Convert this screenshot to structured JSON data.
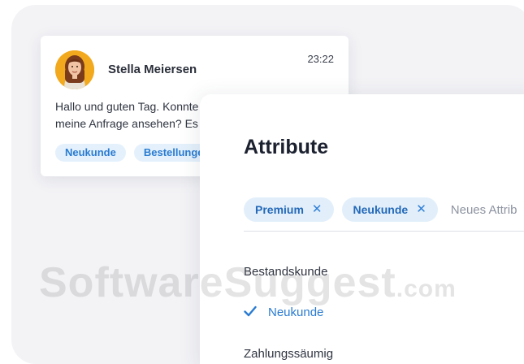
{
  "chat": {
    "name": "Stella Meiersen",
    "time": "23:22",
    "message_line1": "Hallo und guten Tag. Konnte",
    "message_line2": "meine Anfrage ansehen? Es",
    "tags": [
      "Neukunde",
      "Bestellunge"
    ]
  },
  "attributes": {
    "title": "Attribute",
    "selected_tags": [
      "Premium",
      "Neukunde"
    ],
    "input_placeholder": "Neues Attrib",
    "options": [
      {
        "label": "Bestandskunde",
        "selected": false
      },
      {
        "label": "Neukunde",
        "selected": true
      },
      {
        "label": "Zahlungssäumig",
        "selected": false
      }
    ],
    "remove_glyph": "✕"
  },
  "watermark": {
    "main": "SoftwareSuggest",
    "suffix": ".com"
  },
  "colors": {
    "accent": "#2a7bd1",
    "tag_bg": "#e2effb",
    "avatar_bg": "#f2a91e"
  }
}
